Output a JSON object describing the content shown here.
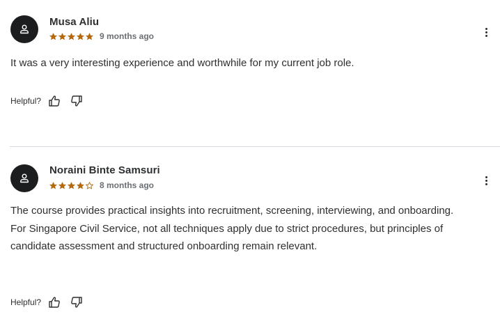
{
  "reviews": [
    {
      "reviewer_name": "Musa Aliu",
      "rating": 5,
      "max_rating": 5,
      "time_ago": "9 months ago",
      "text": "It was a very interesting experience and worthwhile for my current job role.",
      "helpful_label": "Helpful?",
      "avatar_icon": "user-icon",
      "more_icon": "kebab-menu-icon"
    },
    {
      "reviewer_name": "Noraini Binte Samsuri",
      "rating": 4,
      "max_rating": 5,
      "time_ago": "8 months ago",
      "text": "The course provides practical insights into recruitment, screening, interviewing, and onboarding. For Singapore Civil Service, not all techniques apply due to strict procedures, but principles of candidate assessment and structured onboarding remain relevant.",
      "helpful_label": "Helpful?",
      "avatar_icon": "user-icon",
      "more_icon": "kebab-menu-icon"
    }
  ],
  "colors": {
    "star": "#b4690e",
    "avatar_bg": "#1c1d1f",
    "text": "#2d2f31",
    "muted": "#6a6f73",
    "divider": "#d1d7dc"
  }
}
